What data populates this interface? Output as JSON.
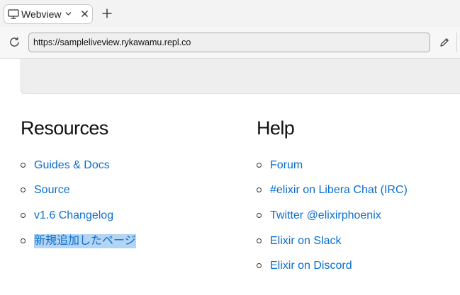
{
  "browser": {
    "tab": {
      "title": "Webview"
    },
    "address_bar": {
      "url": "https://sampleliveview.rykawamu.repl.co"
    }
  },
  "page": {
    "resources": {
      "heading": "Resources",
      "links": [
        "Guides & Docs",
        "Source",
        "v1.6 Changelog",
        "新規追加したページ"
      ],
      "selected_index": 3
    },
    "help": {
      "heading": "Help",
      "links": [
        "Forum",
        "#elixir on Libera Chat (IRC)",
        "Twitter @elixirphoenix",
        "Elixir on Slack",
        "Elixir on Discord"
      ]
    }
  },
  "colors": {
    "link": "#0b6ecf",
    "selection": "#b4d4f3",
    "hero_background": "#eeeeee"
  },
  "icons": {
    "tab": "monitor-icon",
    "tab_menu": "chevron-down-icon",
    "tab_close": "close-icon",
    "new_tab": "plus-icon",
    "reload": "reload-icon",
    "edit": "pencil-icon"
  }
}
